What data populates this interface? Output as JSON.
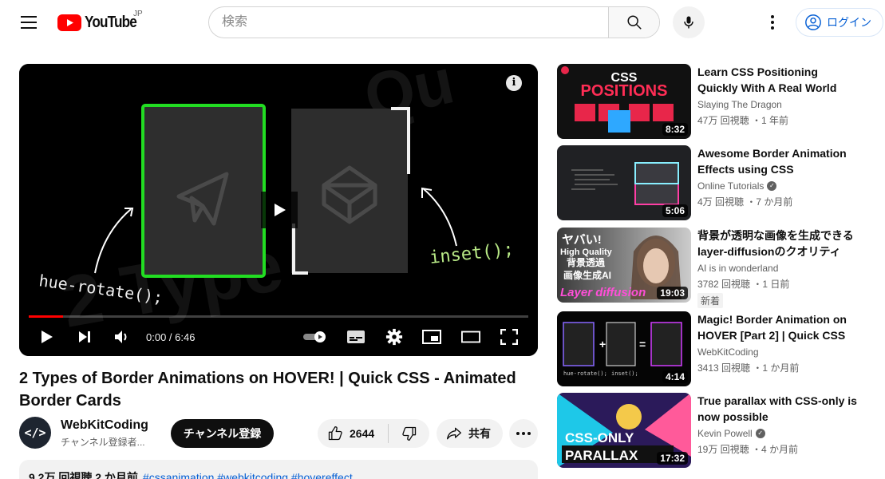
{
  "header": {
    "logo_text": "YouTube",
    "region": "JP",
    "search_placeholder": "検索",
    "login_label": "ログイン"
  },
  "player": {
    "time": "0:00 / 6:46",
    "progress": 0.068,
    "art": {
      "left_caption": "hue-rotate();",
      "right_caption": "inset();"
    }
  },
  "video": {
    "title": "2 Types of Border Animations on HOVER! | Quick CSS - Animated Border Cards",
    "channel": "WebKitCoding",
    "avatar_text": "</>",
    "subscribers": "チャンネル登録者...",
    "subscribe_label": "チャンネル登録",
    "likes": "2644",
    "share_label": "共有",
    "description_stats": "9.2万 回視聴  2 か月前",
    "description_tags": "#cssanimation #webkitcoding #hovereffect"
  },
  "recommendations": [
    {
      "title": "Learn CSS Positioning Quickly With A Real World Example",
      "channel": "Slaying The Dragon",
      "verified": false,
      "meta": "47万 回視聴 ・1 年前",
      "duration": "8:32",
      "badge": "",
      "thumb_text": [
        "CSS",
        "POSITIONS"
      ]
    },
    {
      "title": "Awesome Border Animation Effects using CSS repeating-...",
      "channel": "Online Tutorials",
      "verified": true,
      "meta": "4万 回視聴 ・7 か月前",
      "duration": "5:06",
      "badge": "",
      "thumb_text": []
    },
    {
      "title": "背景が透明な画像を生成できる layer-diffusionのクオリティー...",
      "channel": "AI is in wonderland",
      "verified": false,
      "meta": "3782 回視聴 ・1 日前",
      "duration": "19:03",
      "badge": "新着",
      "thumb_text": [
        "ヤバい!",
        "High Quality",
        "背景透過",
        "画像生成AI",
        "Layer diffusion"
      ]
    },
    {
      "title": "Magic! Border Animation on HOVER [Part 2] | Quick CSS -...",
      "channel": "WebKitCoding",
      "verified": false,
      "meta": "3413 回視聴 ・1 か月前",
      "duration": "4:14",
      "badge": "",
      "thumb_text": [
        "+",
        "=",
        "hue-rotate();",
        "inset();"
      ]
    },
    {
      "title": "True parallax with CSS-only is now possible",
      "channel": "Kevin Powell",
      "verified": true,
      "meta": "19万 回視聴 ・4 か月前",
      "duration": "17:32",
      "badge": "",
      "thumb_text": [
        "CSS-ONLY",
        "PARALLAX"
      ]
    }
  ],
  "colors": {
    "accent": "#065fd4",
    "brand_red": "#ff0000",
    "green_border": "#25d42a",
    "caption_green": "#b8e986",
    "caption_yellow": "#f5d76e"
  }
}
